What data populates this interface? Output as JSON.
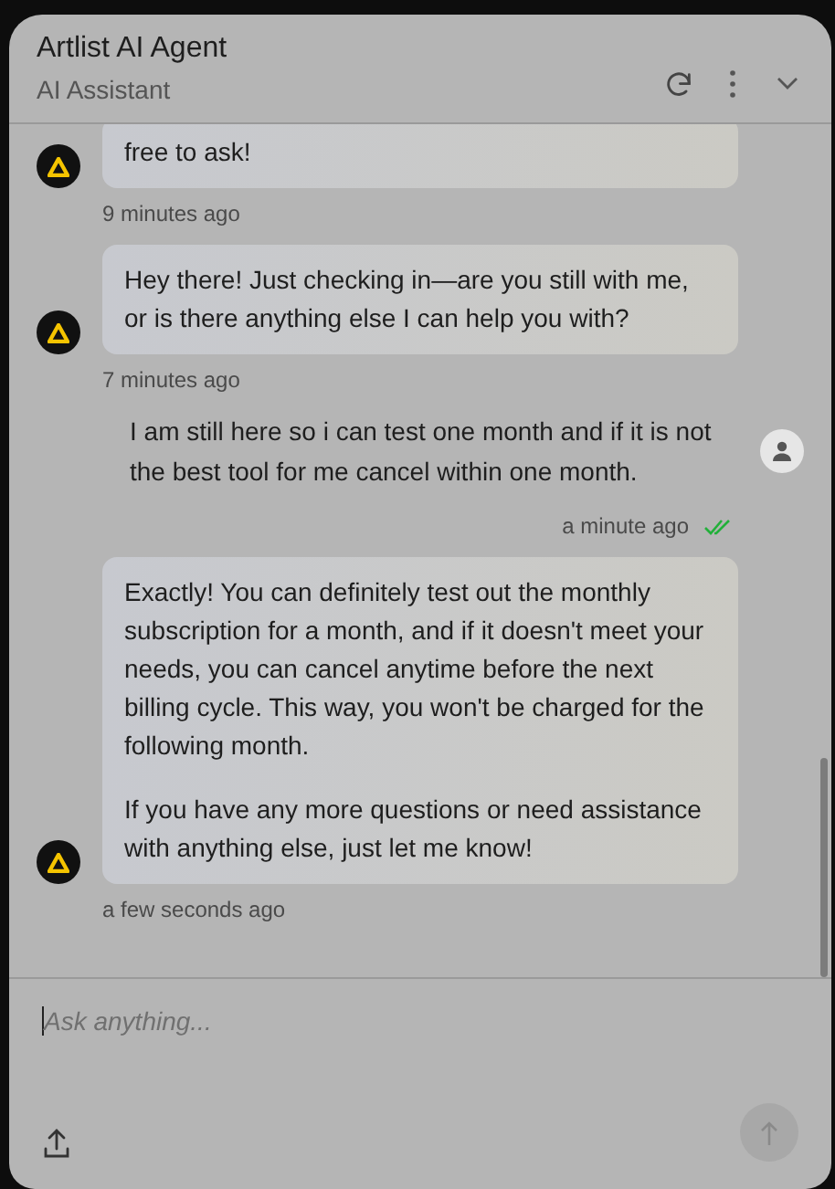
{
  "header": {
    "title": "Artlist AI Agent",
    "subtitle": "AI Assistant"
  },
  "messages": [
    {
      "kind": "bot",
      "paragraphs": [
        "free to ask!"
      ],
      "time": "9 minutes ago"
    },
    {
      "kind": "bot",
      "paragraphs": [
        "Hey there! Just checking in—are you still with me, or is there anything else I can help you with?"
      ],
      "time": "7 minutes ago"
    },
    {
      "kind": "user",
      "paragraphs": [
        "I am still here so i can test one month and if it is not the best tool for me cancel within one month."
      ],
      "time": "a minute ago",
      "read": true
    },
    {
      "kind": "bot",
      "paragraphs": [
        "Exactly! You can definitely test out the monthly subscription for a month, and if it doesn't meet your needs, you can cancel anytime before the next billing cycle. This way, you won't be charged for the following month.",
        "If you have any more questions or need assistance with anything else, just let me know!"
      ],
      "time": "a few seconds ago"
    }
  ],
  "composer": {
    "placeholder": "Ask anything..."
  }
}
